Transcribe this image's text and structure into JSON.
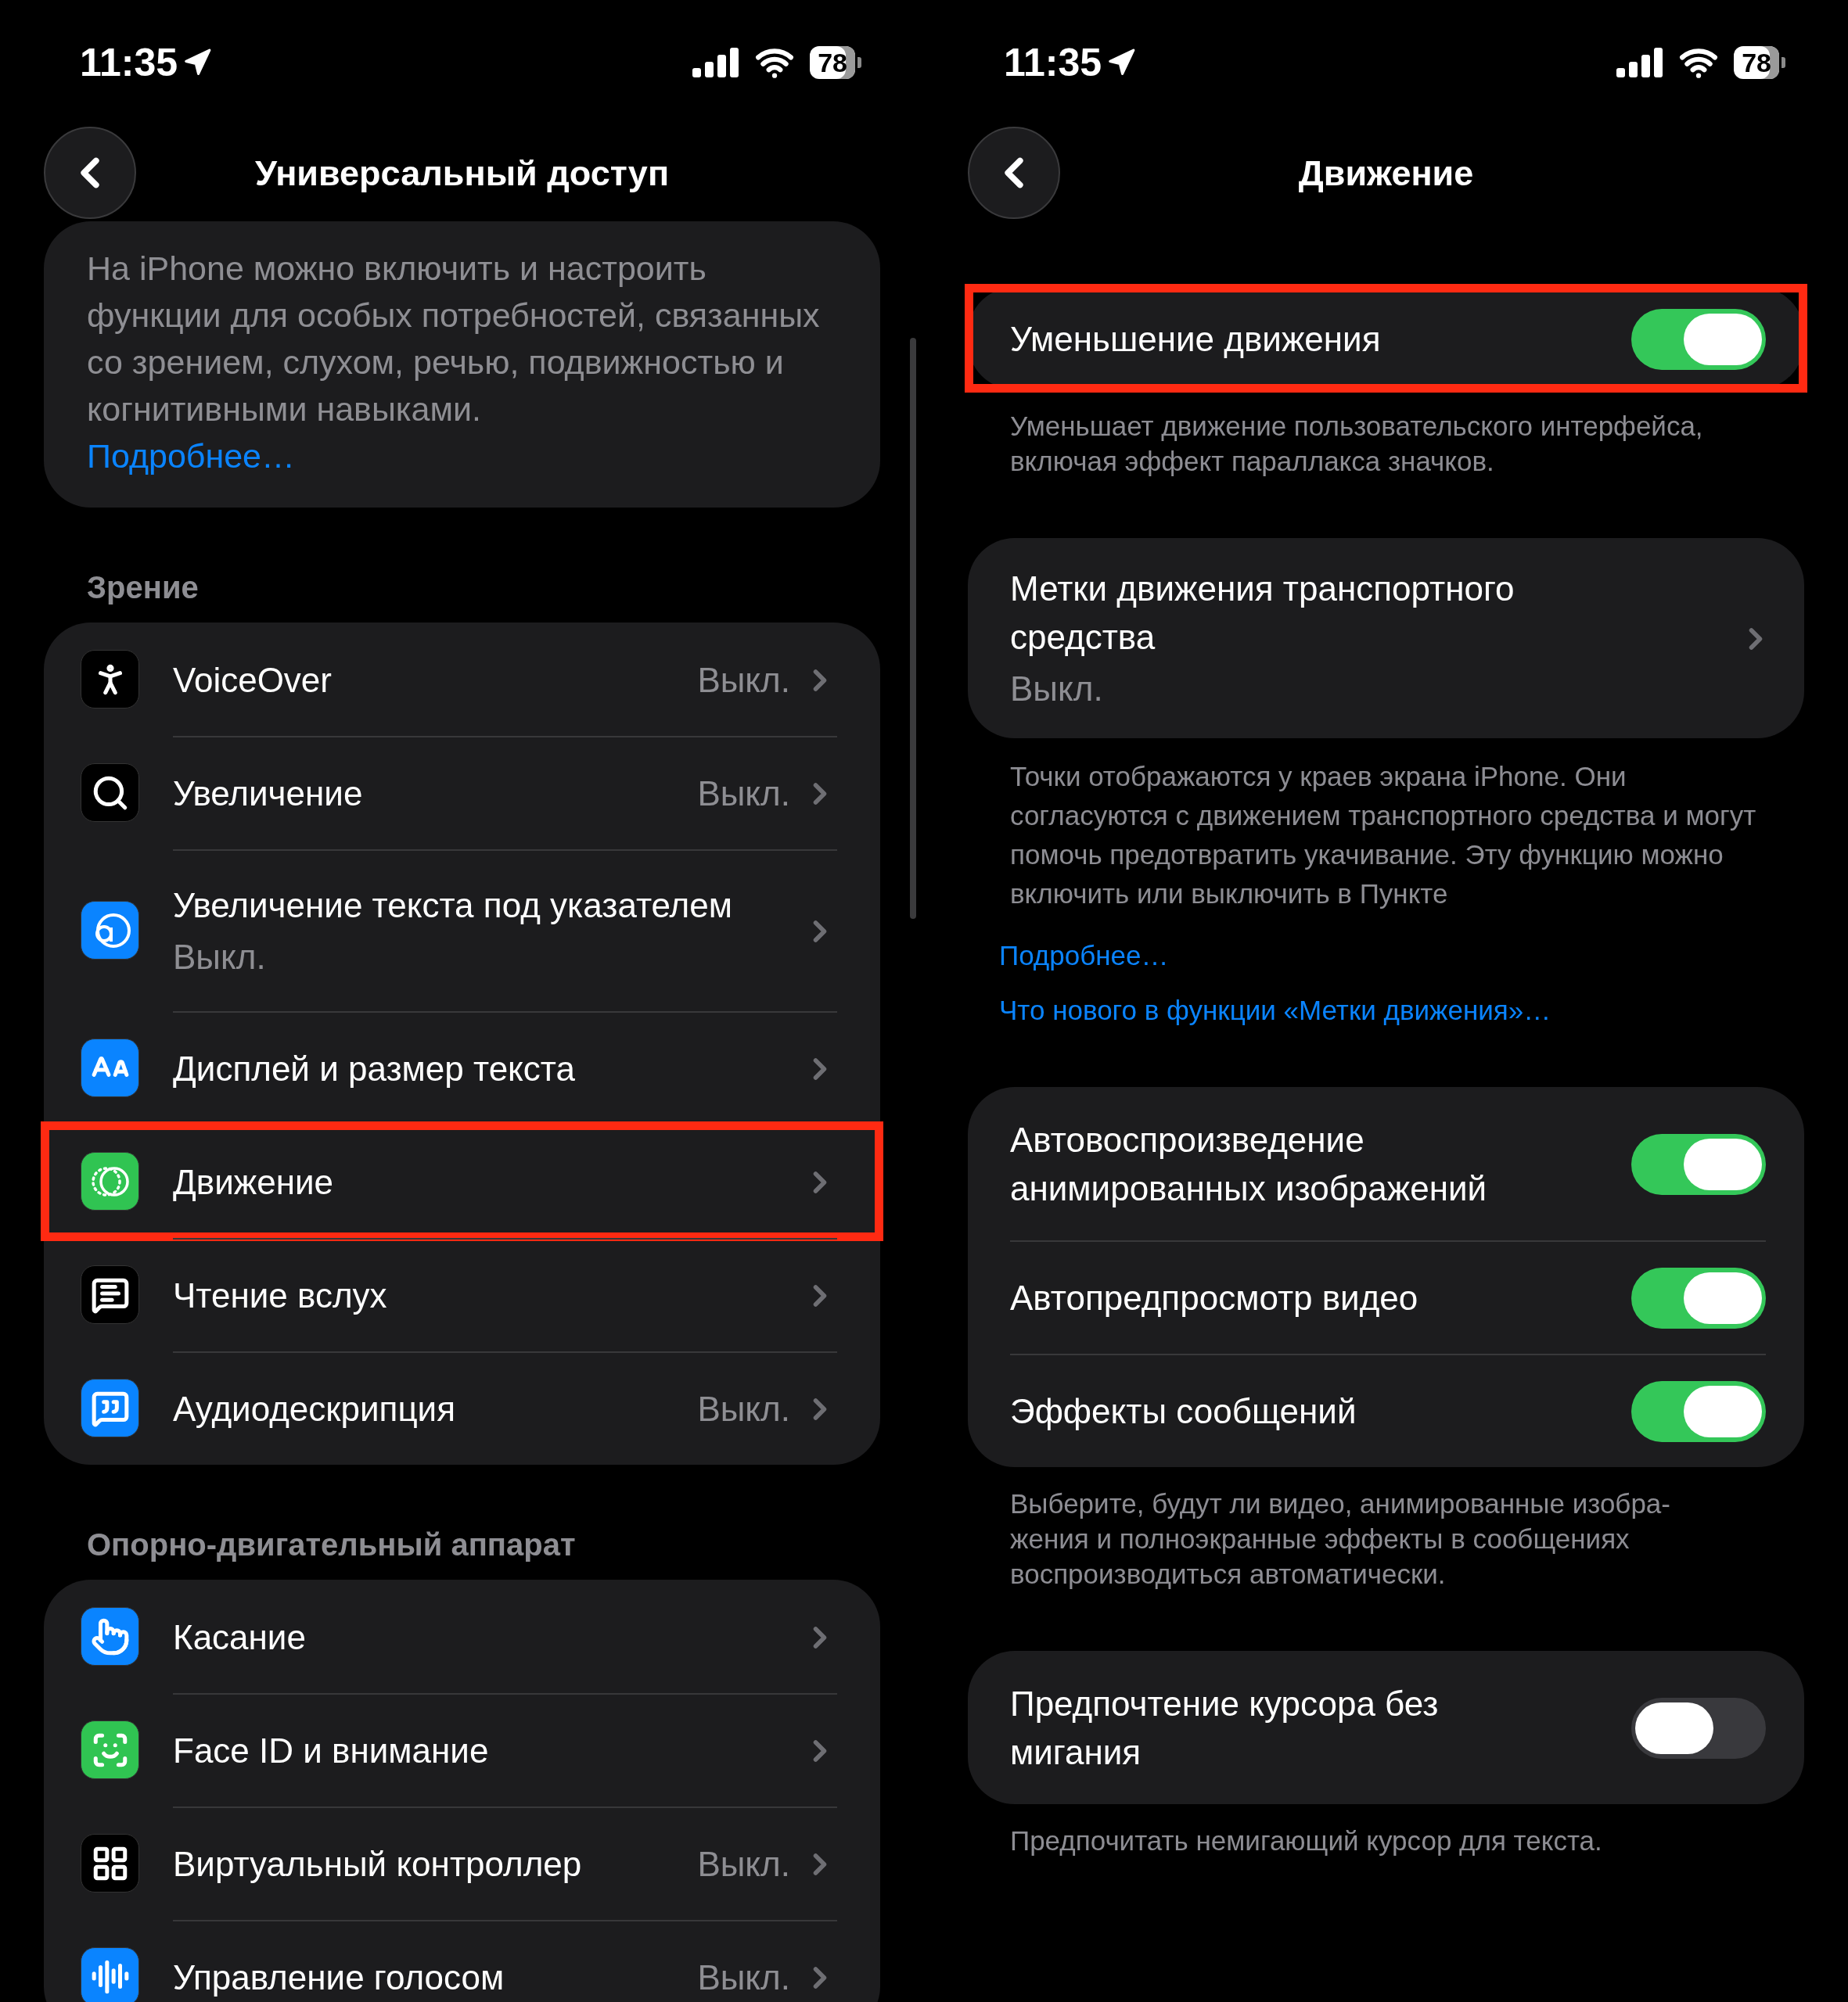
{
  "left": {
    "status_bar": {
      "time": "11:35",
      "battery": "78"
    },
    "nav": {
      "title": "Универсальный доступ"
    },
    "intro": {
      "text": "На iPhone можно включить и настроить функции для особых потребностей, связанных со зрением, слухом, речью, подвижностью и когнитивными навыками.",
      "link": "Подробнее…"
    },
    "sections": [
      {
        "header": "Зрение",
        "items": [
          {
            "kind": "inline",
            "label": "VoiceOver",
            "value": "Выкл.",
            "highlighted": false
          },
          {
            "kind": "inline",
            "label": "Увеличение",
            "value": "Выкл.",
            "highlighted": false
          },
          {
            "kind": "stacked",
            "label": "Увеличение текста под указателем",
            "value": "Выкл.",
            "highlighted": false
          },
          {
            "kind": "inline",
            "label": "Дисплей и размер текста",
            "highlighted": false
          },
          {
            "kind": "inline",
            "label": "Движение",
            "highlighted": true
          },
          {
            "kind": "inline",
            "label": "Чтение вслух",
            "highlighted": false
          },
          {
            "kind": "inline",
            "label": "Аудиодескрипция",
            "value": "Выкл.",
            "highlighted": false
          }
        ]
      },
      {
        "header": "Опорно-двигательный аппарат",
        "items": [
          {
            "kind": "inline",
            "label": "Касание",
            "highlighted": false
          },
          {
            "kind": "inline",
            "label": "Face ID и внимание",
            "highlighted": false
          },
          {
            "kind": "inline",
            "label": "Виртуальный контроллер",
            "value": "Выкл.",
            "highlighted": false
          },
          {
            "kind": "inline",
            "label": "Управление голосом",
            "value": "Выкл.",
            "highlighted": false
          }
        ]
      }
    ]
  },
  "right": {
    "status_bar": {
      "time": "11:35",
      "battery": "78"
    },
    "nav": {
      "title": "Движение"
    },
    "groups": [
      {
        "rows": [
          {
            "kind": "toggle",
            "label": "Уменьшение движения",
            "on": true,
            "highlighted": true
          }
        ],
        "footer": "Уменьшает движение пользовательского интерфейса, включая эффект параллакса значков."
      },
      {
        "rows": [
          {
            "kind": "detail",
            "label": "Метки движения транспортного средства",
            "value": "Выкл.",
            "highlighted": false
          }
        ],
        "footer": "Точки отображаются у краев экрана iPhone. Они согласуются с движением транспортного средства и могут помочь предотвратить укачивание. Эту функцию можно включить или выключить в Пункте",
        "links": [
          "Подробнее…",
          "Что нового в функции «Метки движения»…"
        ]
      },
      {
        "rows": [
          {
            "kind": "toggle",
            "label": "Автовоспроизведение анимированных изображений",
            "on": true,
            "highlighted": false
          },
          {
            "kind": "toggle",
            "label": "Автопредпросмотр видео",
            "on": true,
            "highlighted": false
          },
          {
            "kind": "toggle",
            "label": "Эффекты сообщений",
            "on": true,
            "highlighted": false
          }
        ],
        "footer": "Выберите, будут ли видео, анимированные изобра-\nжения и полноэкранные эффекты в сообщениях\nвоспроизводиться автоматически."
      },
      {
        "rows": [
          {
            "kind": "toggle",
            "label": "Предпочтение курсора без мигания",
            "on": false,
            "highlighted": false
          }
        ],
        "footer": "Предпочитать немигающий курсор для текста."
      }
    ]
  }
}
